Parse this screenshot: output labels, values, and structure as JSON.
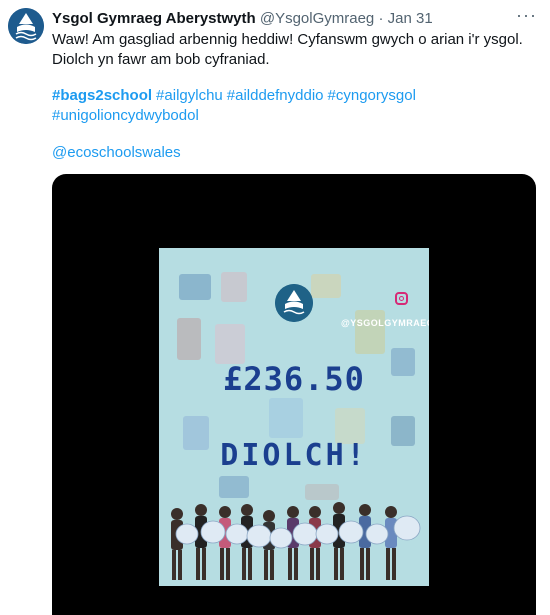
{
  "tweet": {
    "author_name": "Ysgol Gymraeg Aberystwyth",
    "handle": "@YsgolGymraeg",
    "separator": "·",
    "date": "Jan 31",
    "more_label": "···",
    "text_lines": [
      "Waw! Am gasgliad arbennig heddiw! Cyfanswm gwych o arian i'r ysgol.",
      "Diolch yn fawr am bob cyfraniad."
    ],
    "hashtags": [
      "#bags2school",
      "#ailgylchu",
      "#ailddefnyddio",
      "#cyngorysgol",
      "#unigolioncydwybodol"
    ],
    "mention": "@ecoschoolswales"
  },
  "poster": {
    "handle": "@YSGOLGYMRAEG",
    "amount": "£236.50",
    "thanks": "DIOLCH!"
  },
  "colors": {
    "link": "#1d9bf0",
    "poster_background": "#b6dde2",
    "poster_text": "#1b3f8f",
    "avatar": "#1e5b8e"
  }
}
